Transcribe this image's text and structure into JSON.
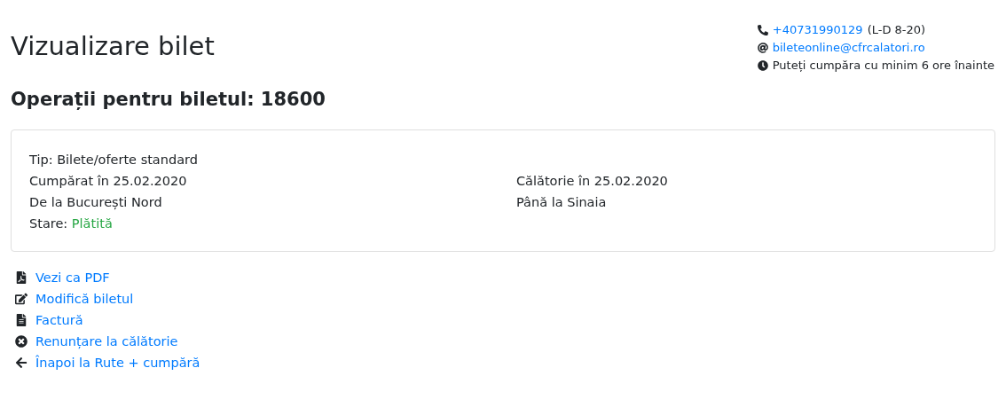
{
  "contact": {
    "phone": "+40731990129",
    "phone_hours": "(L-D 8-20)",
    "email": "bileteonline@cfrcalatori.ro",
    "notice": "Puteți cumpăra cu minim 6 ore înainte"
  },
  "title": "Vizualizare bilet",
  "subtitle": "Operații pentru biletul: 18600",
  "ticket": {
    "type": "Tip: Bilete/oferte standard",
    "purchased": "Cumpărat în 25.02.2020",
    "travel": "Călătorie în 25.02.2020",
    "from": "De la București Nord",
    "to": "Până la Sinaia",
    "status_label": "Stare:",
    "status": "Plătită"
  },
  "actions": [
    {
      "kind": "pdf",
      "label": "Vezi ca PDF"
    },
    {
      "kind": "edit",
      "label": "Modifică biletul"
    },
    {
      "kind": "invoice",
      "label": "Factură"
    },
    {
      "kind": "cancel",
      "label": "Renunțare la călătorie"
    },
    {
      "kind": "back",
      "label": "Înapoi la Rute + cumpără"
    }
  ]
}
